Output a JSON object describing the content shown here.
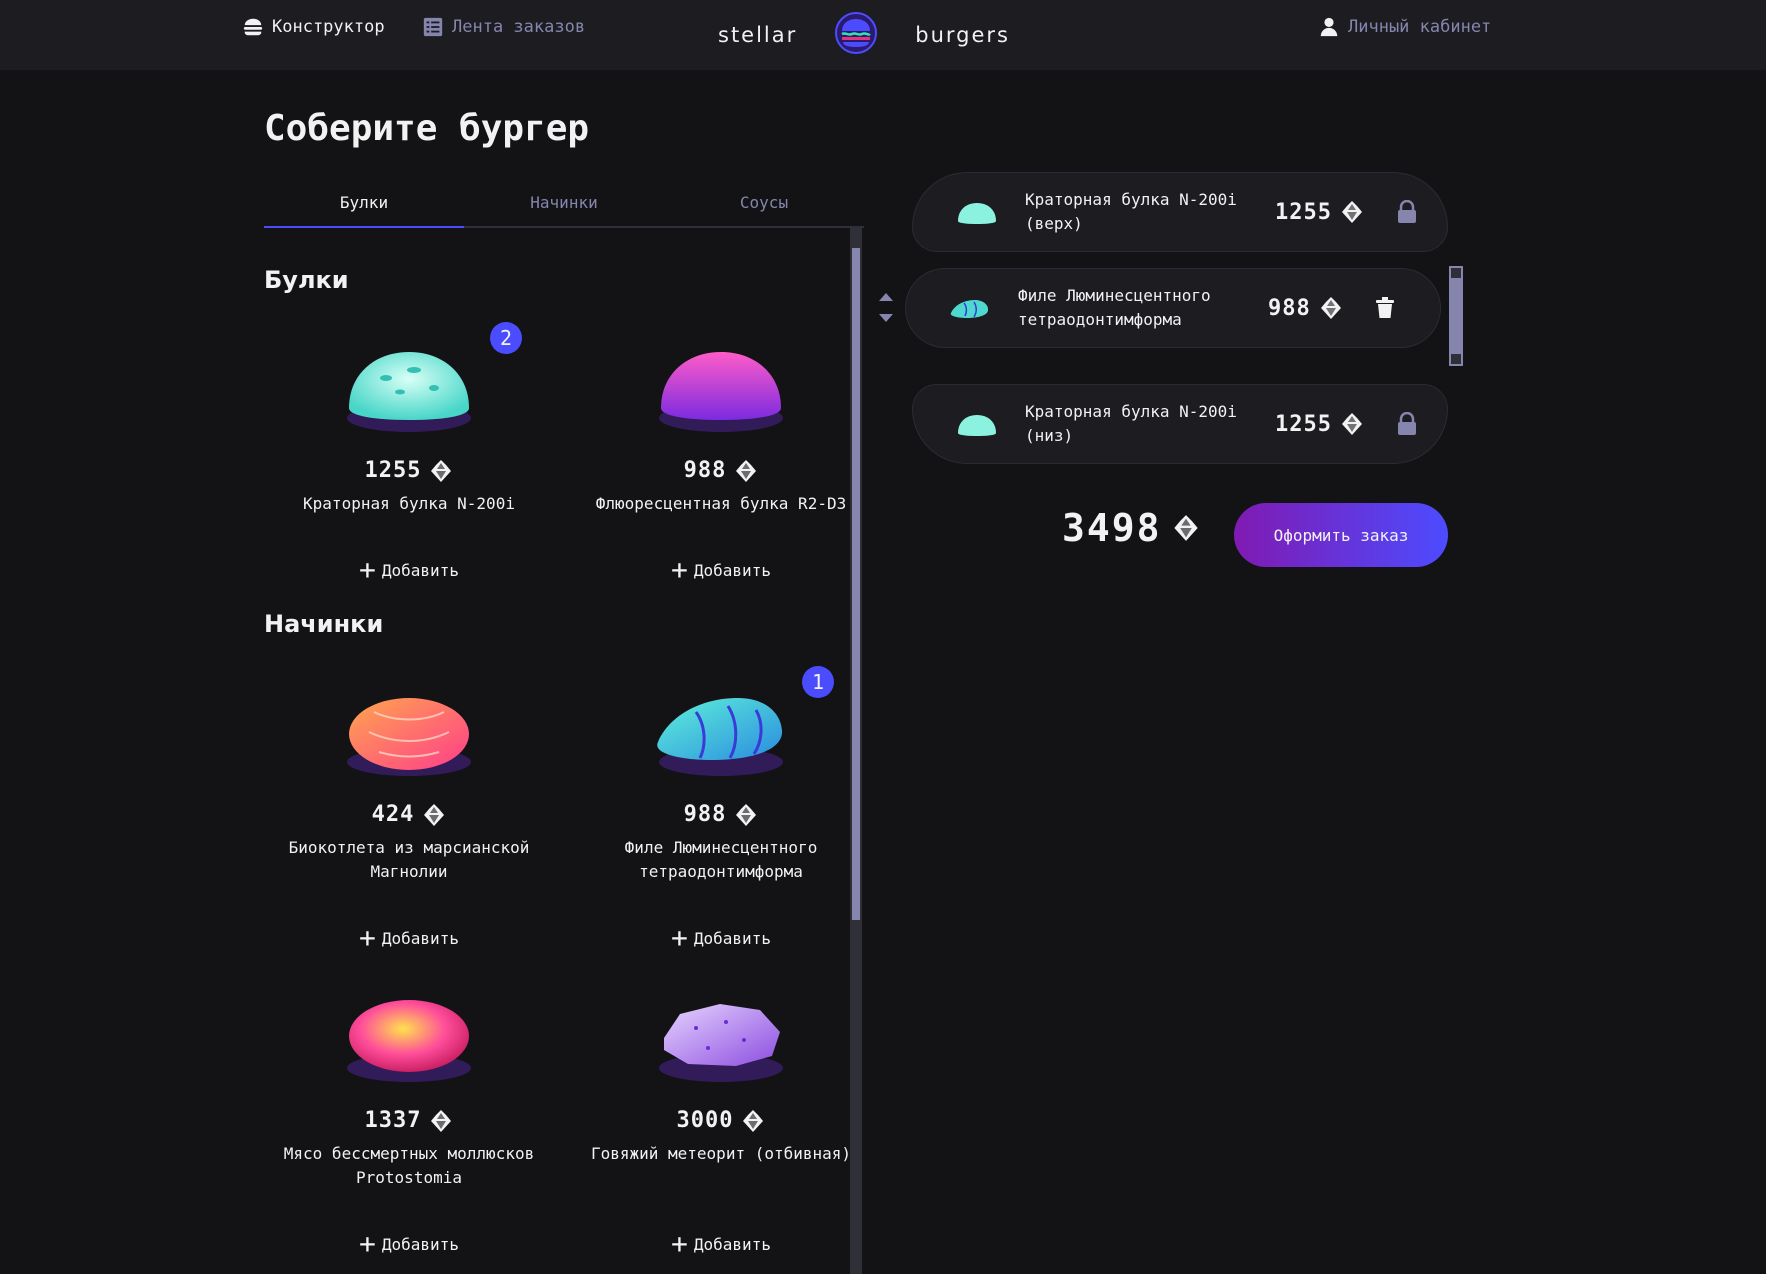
{
  "nav": {
    "constructor_label": "Конструктор",
    "feed_label": "Лента заказов",
    "profile_label": "Личный кабинет",
    "logo_left": "stellar",
    "logo_right": "burgers"
  },
  "page_title": "Соберите бургер",
  "tabs": [
    {
      "label": "Булки",
      "active": true
    },
    {
      "label": "Начинки",
      "active": false
    },
    {
      "label": "Соусы",
      "active": false
    }
  ],
  "sections": {
    "buns_title": "Булки",
    "mains_title": "Начинки"
  },
  "cards": [
    {
      "price": "1255",
      "name": "Краторная булка N-200i",
      "add": "Добавить",
      "count": "2",
      "icon": "crater-bun"
    },
    {
      "price": "988",
      "name": "Флюоресцентная булка R2-D3",
      "add": "Добавить",
      "count": "",
      "icon": "fluorescent-bun"
    },
    {
      "price": "424",
      "name": "Биокотлета из марсианской Магнолии",
      "add": "Добавить",
      "count": "",
      "icon": "bio-cutlet"
    },
    {
      "price": "988",
      "name": "Филе Люминесцентного тетраодонтимформа",
      "add": "Добавить",
      "count": "1",
      "icon": "fish-fillet"
    },
    {
      "price": "1337",
      "name": "Мясо бессмертных моллюсков Protostomia",
      "add": "Добавить",
      "count": "",
      "icon": "mollusk-meat"
    },
    {
      "price": "3000",
      "name": "Говяжий метеорит (отбивная)",
      "add": "Добавить",
      "count": "",
      "icon": "meteorite-beef"
    }
  ],
  "constructor": {
    "top": {
      "name": "Краторная булка N-200i (верх)",
      "price": "1255",
      "action_icon": "lock-icon"
    },
    "middle": [
      {
        "name": "Филе Люминесцентного тетраодонтимформа",
        "price": "988",
        "action_icon": "trash-icon"
      }
    ],
    "bottom": {
      "name": "Краторная булка N-200i (низ)",
      "price": "1255",
      "action_icon": "lock-icon"
    }
  },
  "total": "3498",
  "order_button": "Оформить заказ",
  "colors": {
    "background": "#131316",
    "header": "#1c1c21",
    "accent": "#4c4cff",
    "button_gradient_start": "#801ab2",
    "button_gradient_end": "#4c4cff",
    "inactive_text": "#8585ad"
  }
}
